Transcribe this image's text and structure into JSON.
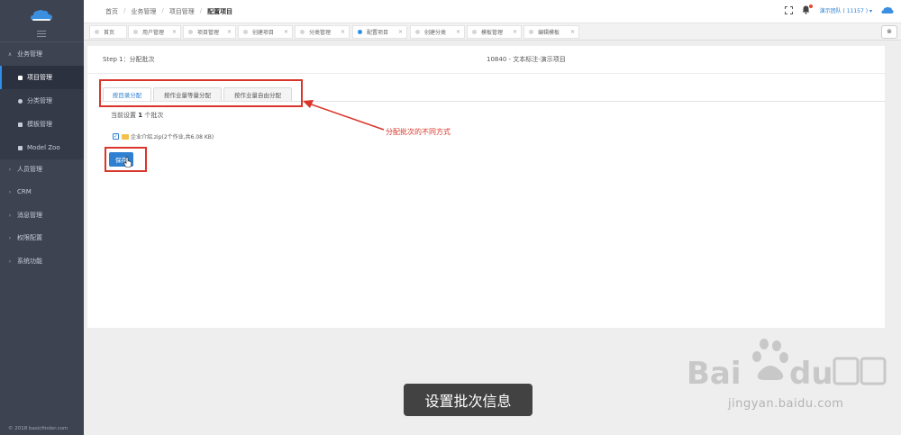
{
  "sidebar": {
    "copyright": "© 2018 basicfinder.com",
    "items": [
      {
        "label": "业务管理",
        "chevron": "∧"
      },
      {
        "label": "项目管理"
      },
      {
        "label": "分类管理"
      },
      {
        "label": "模板管理"
      },
      {
        "label": "Model Zoo"
      },
      {
        "label": "人员管理",
        "chevron": "›"
      },
      {
        "label": "CRM",
        "chevron": "›"
      },
      {
        "label": "消息管理",
        "chevron": "›"
      },
      {
        "label": "权限配置",
        "chevron": "›"
      },
      {
        "label": "系统功能",
        "chevron": "›"
      }
    ]
  },
  "header": {
    "breadcrumb": [
      "首页",
      "业务管理",
      "项目管理",
      "配置项目"
    ],
    "separator": "/",
    "team": "演示团队 ( 11157 ) ▾"
  },
  "tabs": [
    {
      "label": "首页"
    },
    {
      "label": "用户管理",
      "close": "×"
    },
    {
      "label": "项目管理",
      "close": "×"
    },
    {
      "label": "创建项目",
      "close": "×"
    },
    {
      "label": "分类管理",
      "close": "×"
    },
    {
      "label": "配置项目",
      "close": "×"
    },
    {
      "label": "创建分类",
      "close": "×"
    },
    {
      "label": "模板管理",
      "close": "×"
    },
    {
      "label": "编辑模板",
      "close": "×"
    }
  ],
  "tab_close_all": "⊗",
  "content": {
    "step": "Step 1：分配批次",
    "project": "10840 - 文本标注-演示项目",
    "method_tabs": [
      "按目录分配",
      "按作业量等量分配",
      "按作业量自由分配"
    ],
    "count_prefix": "当前设置",
    "count_value": "1",
    "count_suffix": "个批次",
    "check_mark": "✓",
    "file": "企业介绍.zip(2个作业,共6.08 KB)",
    "save_label": "保存"
  },
  "annotation": "分配批次的不同方式",
  "caption": "设置批次信息",
  "watermark": "jingyan.baidu.com",
  "colors": {
    "accent": "#2f80d1",
    "annotation": "#d9352b",
    "sidebar": "#3e4352"
  }
}
